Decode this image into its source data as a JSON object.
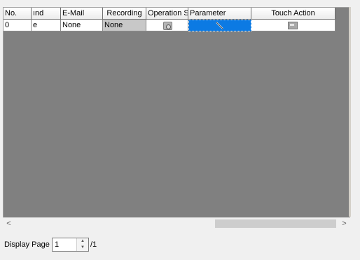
{
  "grid": {
    "headers": {
      "no": "No.",
      "sound": "ınd",
      "email": "E-Mail",
      "recording": "Recording",
      "operation": "Operation S",
      "parameter": "Parameter",
      "touch_action": "Touch Action"
    },
    "rows": [
      {
        "no": "0",
        "sound": "e",
        "email": "None",
        "recording": "None",
        "operation_icon": "gear-icon",
        "parameter_icon": "edit-pencil-icon",
        "touch_action_icon": "touch-action-icon"
      }
    ],
    "selected_cell": "parameter",
    "colors": {
      "grid_background": "#808080",
      "selection": "#0c7ae3",
      "recording_cell": "#c8c8c8"
    }
  },
  "scrollbar": {
    "left_arrow": "<",
    "right_arrow": ">"
  },
  "pager": {
    "label": "Display Page",
    "current_page": "1",
    "total": "/1"
  }
}
